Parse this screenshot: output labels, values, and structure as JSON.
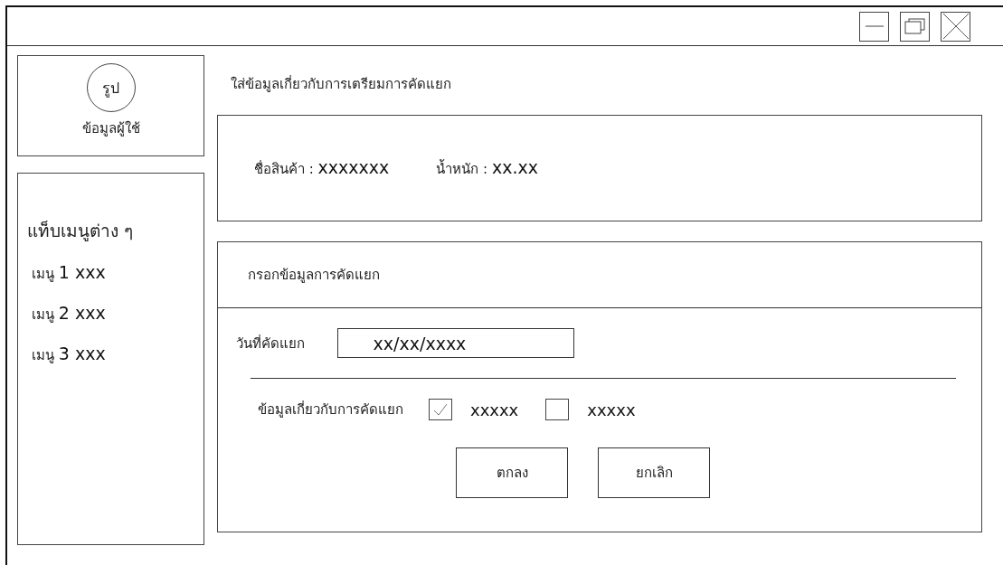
{
  "window": {
    "controls": [
      {
        "kind": "minimize"
      },
      {
        "kind": "restore"
      },
      {
        "kind": "close"
      }
    ]
  },
  "profile": {
    "avatar": "รูป",
    "label": "ข้อมูลผู้ใช้"
  },
  "sidebar": {
    "title": "แท็บเมนูต่าง ๆ",
    "items": [
      {
        "prefix": "เมนู",
        "label": "1 xxx"
      },
      {
        "prefix": "เมนู",
        "label": "2 xxx"
      },
      {
        "prefix": "เมนู",
        "label": "3 xxx"
      }
    ]
  },
  "heading": "ใส่ข้อมูลเกี่ยวกับการเตรียมการคัดแยก",
  "info": [
    {
      "label": "ชื่อสินค้า :",
      "value": "xxxxxxx"
    },
    {
      "label": "น้ำหนัก :",
      "value": "xx.xx"
    }
  ],
  "form": {
    "title": "กรอกข้อมูลการคัดแยก",
    "date": {
      "label": "วันที่คัดแยก",
      "value": "xx/xx/xxxx"
    },
    "options": {
      "label": "ข้อมูลเกี่ยวกับการคัดแยก",
      "items": [
        {
          "label": "xxxxx",
          "checked": true
        },
        {
          "label": "xxxxx",
          "checked": false
        }
      ]
    },
    "buttons": [
      "ตกลง",
      "ยกเลิก"
    ]
  }
}
